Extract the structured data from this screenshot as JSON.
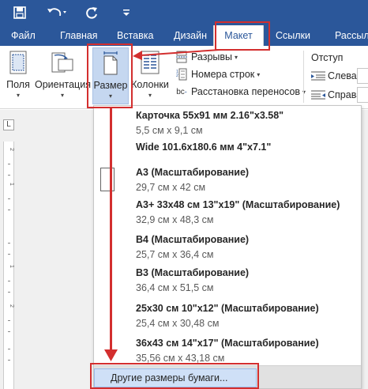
{
  "quick_access": {
    "icons": [
      "save-icon",
      "undo-icon",
      "redo-icon",
      "customize-toolbar-icon"
    ]
  },
  "tabs": [
    {
      "label": "Файл"
    },
    {
      "label": "Главная"
    },
    {
      "label": "Вставка"
    },
    {
      "label": "Дизайн"
    },
    {
      "label": "Макет",
      "active": true
    },
    {
      "label": "Ссылки"
    },
    {
      "label": "Рассыл"
    }
  ],
  "ribbon": {
    "margins_label": "Поля",
    "orientation_label": "Ориентация",
    "size_label": "Размер",
    "columns_label": "Колонки",
    "breaks_label": "Разрывы",
    "line_numbers_label": "Номера строк",
    "hyphenation_label": "Расстановка переносов",
    "hyphenation_icon_text": "bc",
    "indent_title": "Отступ",
    "indent_left_label": "Слева:",
    "indent_right_label": "Справа:"
  },
  "ruler": {
    "corner_glyph": "L",
    "numbers": [
      "2",
      "1",
      "1",
      "2"
    ]
  },
  "size_menu": {
    "items": [
      {
        "name": "Карточка 55x91 мм 2.16\"x3.58\"",
        "dims": "5,5 см x 9,1 см"
      },
      {
        "name": "Wide 101.6x180.6 мм 4\"x7.1\"",
        "dims": ""
      },
      {
        "name": "A3 (Масштабирование)",
        "dims": "29,7 см x 42 см"
      },
      {
        "name": "A3+ 33x48 см 13\"x19\" (Масштабирование)",
        "dims": "32,9 см x 48,3 см"
      },
      {
        "name": "B4 (Масштабирование)",
        "dims": "25,7 см x 36,4 см"
      },
      {
        "name": "B3 (Масштабирование)",
        "dims": "36,4 см x 51,5 см"
      },
      {
        "name": "25x30 см 10\"x12\" (Масштабирование)",
        "dims": "25,4 см x 30,48 см"
      },
      {
        "name": "36x43 см 14\"x17\" (Масштабирование)",
        "dims": "35,56 см x 43,18 см"
      }
    ],
    "more_sizes_label": "Другие размеры бумаги..."
  },
  "colors": {
    "word_blue": "#2b579a",
    "annotation_red": "#d32f2f",
    "pressed_button": "#c5d7f0",
    "hover_item": "#cfe0f7"
  }
}
